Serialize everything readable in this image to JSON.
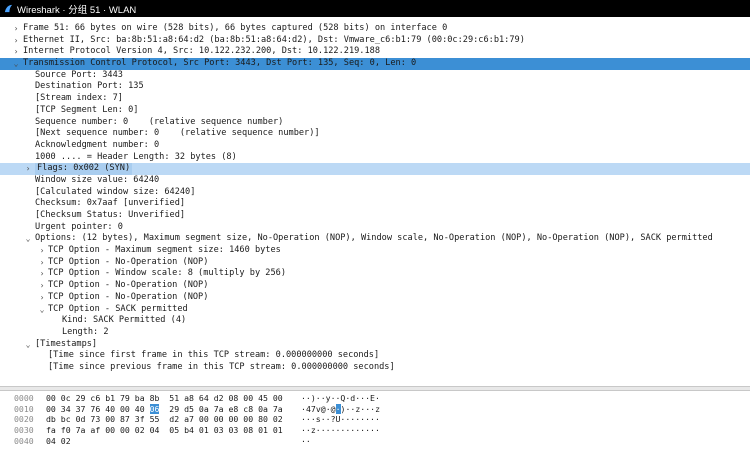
{
  "window": {
    "title": "Wireshark · 分组 51 · WLAN"
  },
  "tree": [
    {
      "indent": 0,
      "arrow": "›",
      "text": "Frame 51: 66 bytes on wire (528 bits), 66 bytes captured (528 bits) on interface 0",
      "state": ""
    },
    {
      "indent": 0,
      "arrow": "›",
      "text": "Ethernet II, Src: ba:8b:51:a8:64:d2 (ba:8b:51:a8:64:d2), Dst: Vmware_c6:b1:79 (00:0c:29:c6:b1:79)",
      "state": ""
    },
    {
      "indent": 0,
      "arrow": "›",
      "text": "Internet Protocol Version 4, Src: 10.122.232.200, Dst: 10.122.219.188",
      "state": ""
    },
    {
      "indent": 0,
      "arrow": "⌄",
      "text": "Transmission Control Protocol, Src Port: 3443, Dst Port: 135, Seq: 0, Len: 0",
      "state": "sel"
    },
    {
      "indent": 1,
      "arrow": "",
      "text": "Source Port: 3443",
      "state": ""
    },
    {
      "indent": 1,
      "arrow": "",
      "text": "Destination Port: 135",
      "state": ""
    },
    {
      "indent": 1,
      "arrow": "",
      "text": "[Stream index: 7]",
      "state": ""
    },
    {
      "indent": 1,
      "arrow": "",
      "text": "[TCP Segment Len: 0]",
      "state": ""
    },
    {
      "indent": 1,
      "arrow": "",
      "text": "Sequence number: 0    (relative sequence number)",
      "state": ""
    },
    {
      "indent": 1,
      "arrow": "",
      "text": "[Next sequence number: 0    (relative sequence number)]",
      "state": ""
    },
    {
      "indent": 1,
      "arrow": "",
      "text": "Acknowledgment number: 0",
      "state": ""
    },
    {
      "indent": 1,
      "arrow": "",
      "text": "1000 .... = Header Length: 32 bytes (8)",
      "state": ""
    },
    {
      "indent": 1,
      "arrow": "›",
      "text": "Flags: 0x002 (SYN)",
      "state": "hl"
    },
    {
      "indent": 1,
      "arrow": "",
      "text": "Window size value: 64240",
      "state": ""
    },
    {
      "indent": 1,
      "arrow": "",
      "text": "[Calculated window size: 64240]",
      "state": ""
    },
    {
      "indent": 1,
      "arrow": "",
      "text": "Checksum: 0x7aaf [unverified]",
      "state": ""
    },
    {
      "indent": 1,
      "arrow": "",
      "text": "[Checksum Status: Unverified]",
      "state": ""
    },
    {
      "indent": 1,
      "arrow": "",
      "text": "Urgent pointer: 0",
      "state": ""
    },
    {
      "indent": 1,
      "arrow": "⌄",
      "text": "Options: (12 bytes), Maximum segment size, No-Operation (NOP), Window scale, No-Operation (NOP), No-Operation (NOP), SACK permitted",
      "state": ""
    },
    {
      "indent": 2,
      "arrow": "›",
      "text": "TCP Option - Maximum segment size: 1460 bytes",
      "state": ""
    },
    {
      "indent": 2,
      "arrow": "›",
      "text": "TCP Option - No-Operation (NOP)",
      "state": ""
    },
    {
      "indent": 2,
      "arrow": "›",
      "text": "TCP Option - Window scale: 8 (multiply by 256)",
      "state": ""
    },
    {
      "indent": 2,
      "arrow": "›",
      "text": "TCP Option - No-Operation (NOP)",
      "state": ""
    },
    {
      "indent": 2,
      "arrow": "›",
      "text": "TCP Option - No-Operation (NOP)",
      "state": ""
    },
    {
      "indent": 2,
      "arrow": "⌄",
      "text": "TCP Option - SACK permitted",
      "state": ""
    },
    {
      "indent": 3,
      "arrow": "",
      "text": "Kind: SACK Permitted (4)",
      "state": ""
    },
    {
      "indent": 3,
      "arrow": "",
      "text": "Length: 2",
      "state": ""
    },
    {
      "indent": 1,
      "arrow": "⌄",
      "text": "[Timestamps]",
      "state": ""
    },
    {
      "indent": 2,
      "arrow": "",
      "text": "[Time since first frame in this TCP stream: 0.000000000 seconds]",
      "state": ""
    },
    {
      "indent": 2,
      "arrow": "",
      "text": "[Time since previous frame in this TCP stream: 0.000000000 seconds]",
      "state": ""
    }
  ],
  "hex_dump": [
    {
      "offset": "0000",
      "bytes": [
        "00",
        "0c",
        "29",
        "c6",
        "b1",
        "79",
        "ba",
        "8b",
        "51",
        "a8",
        "64",
        "d2",
        "08",
        "00",
        "45",
        "00"
      ],
      "ascii": "··)··y··Q·d···E·",
      "hl_bytes": [],
      "hl_ascii": []
    },
    {
      "offset": "0010",
      "bytes": [
        "00",
        "34",
        "37",
        "76",
        "40",
        "00",
        "40",
        "06",
        "29",
        "d5",
        "0a",
        "7a",
        "e8",
        "c8",
        "0a",
        "7a"
      ],
      "ascii": "·47v@·@·)··z···z",
      "hl_bytes": [
        7
      ],
      "hl_ascii": [
        7
      ]
    },
    {
      "offset": "0020",
      "bytes": [
        "db",
        "bc",
        "0d",
        "73",
        "00",
        "87",
        "3f",
        "55",
        "d2",
        "a7",
        "00",
        "00",
        "00",
        "00",
        "80",
        "02"
      ],
      "ascii": "···s··?U········",
      "hl_bytes": [],
      "hl_ascii": []
    },
    {
      "offset": "0030",
      "bytes": [
        "fa",
        "f0",
        "7a",
        "af",
        "00",
        "00",
        "02",
        "04",
        "05",
        "b4",
        "01",
        "03",
        "03",
        "08",
        "01",
        "01"
      ],
      "ascii": "··z·············",
      "hl_bytes": [],
      "hl_ascii": []
    },
    {
      "offset": "0040",
      "bytes": [
        "04",
        "02"
      ],
      "ascii": "··",
      "hl_bytes": [],
      "hl_ascii": []
    }
  ],
  "colors": {
    "selection": "#3c8fd5",
    "flag_highlight": "#bcd9f5",
    "titlebar": "#000000"
  }
}
